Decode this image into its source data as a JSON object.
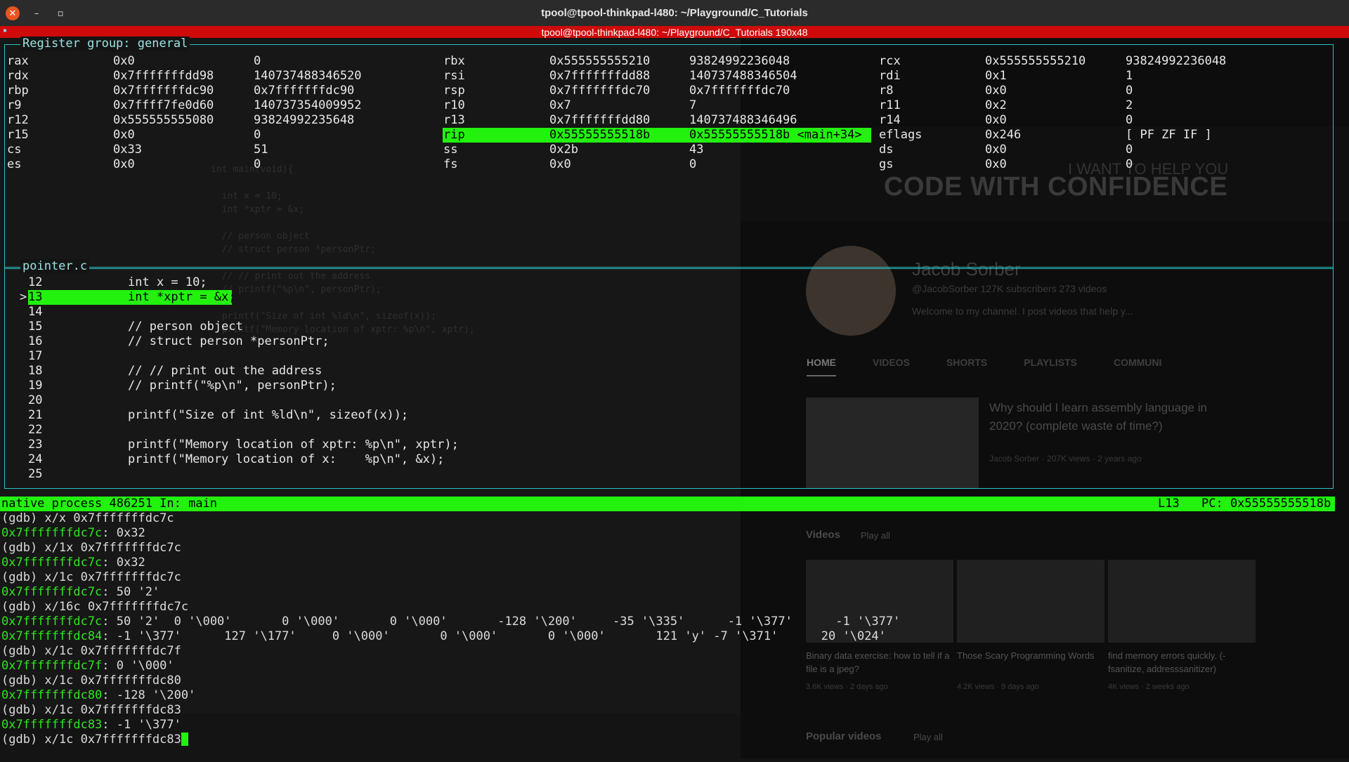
{
  "window": {
    "title": "tpool@tpool-thinkpad-l480: ~/Playground/C_Tutorials",
    "tmux_status": "tpool@tpool-thinkpad-l480: ~/Playground/C_Tutorials 190x48",
    "close_glyph": "✕",
    "min_glyph": "–",
    "max_glyph": "▫"
  },
  "registers": {
    "title": "Register group: general",
    "highlight_color": "#22f20e",
    "col_a": [
      {
        "name": "rax",
        "hex": "0x0",
        "val": "0"
      },
      {
        "name": "rdx",
        "hex": "0x7fffffffdd98",
        "val": "140737488346520"
      },
      {
        "name": "rbp",
        "hex": "0x7fffffffdc90",
        "val": "0x7fffffffdc90"
      },
      {
        "name": "r9",
        "hex": "0x7ffff7fe0d60",
        "val": "140737354009952"
      },
      {
        "name": "r12",
        "hex": "0x555555555080",
        "val": "93824992235648"
      },
      {
        "name": "r15",
        "hex": "0x0",
        "val": "0"
      },
      {
        "name": "cs",
        "hex": "0x33",
        "val": "51"
      },
      {
        "name": "es",
        "hex": "0x0",
        "val": "0"
      }
    ],
    "col_b": [
      {
        "name": "rbx",
        "hex": "0x555555555210",
        "val": "93824992236048"
      },
      {
        "name": "rsi",
        "hex": "0x7fffffffdd88",
        "val": "140737488346504"
      },
      {
        "name": "rsp",
        "hex": "0x7fffffffdc70",
        "val": "0x7fffffffdc70"
      },
      {
        "name": "r10",
        "hex": "0x7",
        "val": "7"
      },
      {
        "name": "r13",
        "hex": "0x7fffffffdd80",
        "val": "140737488346496"
      },
      {
        "name": "rip",
        "hex": "0x55555555518b",
        "val": "0x55555555518b <main+34>"
      },
      {
        "name": "ss",
        "hex": "0x2b",
        "val": "43"
      },
      {
        "name": "fs",
        "hex": "0x0",
        "val": "0"
      }
    ],
    "col_c": [
      {
        "name": "rcx",
        "hex": "0x555555555210",
        "val": "93824992236048"
      },
      {
        "name": "rdi",
        "hex": "0x1",
        "val": "1"
      },
      {
        "name": "r8",
        "hex": "0x0",
        "val": "0"
      },
      {
        "name": "r11",
        "hex": "0x2",
        "val": "2"
      },
      {
        "name": "r14",
        "hex": "0x0",
        "val": "0"
      },
      {
        "name": "eflags",
        "hex": "0x246",
        "val": "[ PF ZF IF ]"
      },
      {
        "name": "ds",
        "hex": "0x0",
        "val": "0"
      },
      {
        "name": "gs",
        "hex": "0x0",
        "val": "0"
      }
    ]
  },
  "source": {
    "title": "pointer.c",
    "marker": ">",
    "lines": [
      {
        "num": "12",
        "code": "int x = 10;"
      },
      {
        "num": "13",
        "code": "int *xptr = &x;"
      },
      {
        "num": "14",
        "code": ""
      },
      {
        "num": "15",
        "code": "// person object"
      },
      {
        "num": "16",
        "code": "// struct person *personPtr;"
      },
      {
        "num": "17",
        "code": ""
      },
      {
        "num": "18",
        "code": "// // print out the address"
      },
      {
        "num": "19",
        "code": "// printf(\"%p\\n\", personPtr);"
      },
      {
        "num": "20",
        "code": ""
      },
      {
        "num": "21",
        "code": "printf(\"Size of int %ld\\n\", sizeof(x));"
      },
      {
        "num": "22",
        "code": ""
      },
      {
        "num": "23",
        "code": "printf(\"Memory location of xptr: %p\\n\", xptr);"
      },
      {
        "num": "24",
        "code": "printf(\"Memory location of x:    %p\\n\", &x);"
      },
      {
        "num": "25",
        "code": ""
      }
    ]
  },
  "status": {
    "left": "native process 486251 In: main",
    "line": "L13",
    "pc": "PC: 0x55555555518b"
  },
  "gdb": [
    {
      "prefix": "",
      "addr": "",
      "text": "(gdb) x/x 0x7fffffffdc7c"
    },
    {
      "prefix": "",
      "addr": "0x7fffffffdc7c",
      "text": ": 0x32"
    },
    {
      "prefix": "",
      "addr": "",
      "text": "(gdb) x/1x 0x7fffffffdc7c"
    },
    {
      "prefix": "",
      "addr": "0x7fffffffdc7c",
      "text": ": 0x32"
    },
    {
      "prefix": "",
      "addr": "",
      "text": "(gdb) x/1c 0x7fffffffdc7c"
    },
    {
      "prefix": "",
      "addr": "0x7fffffffdc7c",
      "text": ": 50 '2'"
    },
    {
      "prefix": "",
      "addr": "",
      "text": "(gdb) x/16c 0x7fffffffdc7c"
    },
    {
      "prefix": "",
      "addr": "0x7fffffffdc7c",
      "text": ": 50 '2'  0 '\\000'       0 '\\000'       0 '\\000'       -128 '\\200'     -35 '\\335'      -1 '\\377'      -1 '\\377'"
    },
    {
      "prefix": "",
      "addr": "0x7fffffffdc84",
      "text": ": -1 '\\377'      127 '\\177'     0 '\\000'       0 '\\000'       0 '\\000'       121 'y' -7 '\\371'      20 '\\024'"
    },
    {
      "prefix": "",
      "addr": "",
      "text": "(gdb) x/1c 0x7fffffffdc7f"
    },
    {
      "prefix": "",
      "addr": "0x7fffffffdc7f",
      "text": ": 0 '\\000'"
    },
    {
      "prefix": "",
      "addr": "",
      "text": "(gdb) x/1c 0x7fffffffdc80"
    },
    {
      "prefix": "",
      "addr": "0x7fffffffdc80",
      "text": ": -128 '\\200'"
    },
    {
      "prefix": "",
      "addr": "",
      "text": "(gdb) x/1c 0x7fffffffdc83"
    },
    {
      "prefix": "",
      "addr": "0x7fffffffdc83",
      "text": ": -1 '\\377'"
    },
    {
      "prefix": "",
      "addr": "",
      "text": "(gdb) x/1c 0x7fffffffdc83"
    }
  ],
  "background": {
    "banner_title": "CODE WITH CONFIDENCE",
    "banner_sub": "I WANT TO HELP YOU",
    "channel_name": "Jacob Sorber",
    "channel_meta": "@JacobSorber  127K subscribers  273 videos",
    "channel_desc": "Welcome to my channel. I post videos that help y...",
    "tabs": [
      "HOME",
      "VIDEOS",
      "SHORTS",
      "PLAYLISTS",
      "COMMUNI"
    ],
    "feature_title": "Why should I learn assembly language in 2020? (complete waste of time?)",
    "feature_meta": "Jacob Sorber · 207K views · 2 years ago",
    "videos_section": "Videos",
    "popular_section": "Popular videos",
    "play_all": "Play all",
    "videos": [
      {
        "title": "Binary data exercise: how to tell if a file is a jpeg?",
        "meta": "3.6K views · 2 days ago"
      },
      {
        "title": "Those Scary Programming Words",
        "meta": "4.2K views · 9 days ago"
      },
      {
        "title": "find memory errors quickly. (-fsanitize, addresssanitizer)",
        "meta": "4K views · 2 weeks ago"
      }
    ],
    "code_ghost": "int main(void){\n\n  int x = 10;\n  int *xptr = &x;\n\n  // person object\n  // struct person *personPtr;\n\n  // // print out the address\n  // printf(\"%p\\n\", personPtr);\n\n  printf(\"Size of int %ld\\n\", sizeof(x));\n  printf(\"Memory location of xptr: %p\\n\", xptr);"
  }
}
